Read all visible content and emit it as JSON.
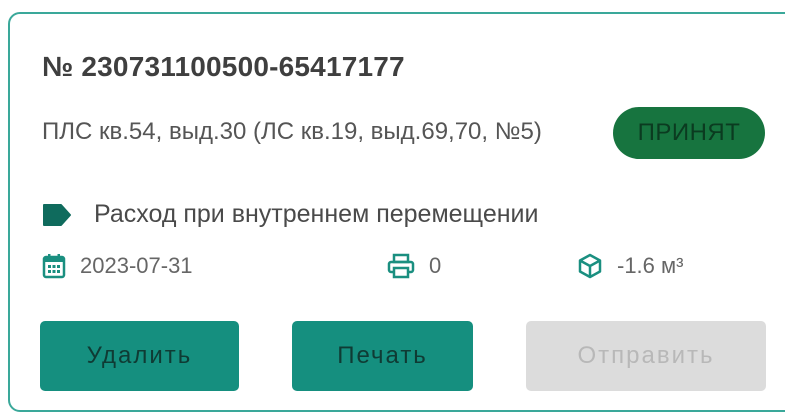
{
  "card": {
    "document_number": "№ 230731100500-65417177",
    "address": "ПЛС кв.54, выд.30 (ЛС кв.19, выд.69,70, №5)",
    "status_badge": "ПРИНЯТ",
    "operation_type": "Расход при внутреннем перемещении",
    "date": "2023-07-31",
    "print_count": "0",
    "volume": "-1.6 м³",
    "icons": {
      "operation": "tag-icon",
      "date": "calendar-icon",
      "print": "printer-icon",
      "volume": "cube-icon"
    }
  },
  "actions": {
    "delete_label": "Удалить",
    "print_label": "Печать",
    "send_label": "Отправить"
  },
  "colors": {
    "accent": "#158f7f",
    "card_border": "#3aa89a",
    "status_bg": "#17743f",
    "disabled_bg": "#dcdcdc",
    "tag_icon": "#0f6b5d"
  }
}
